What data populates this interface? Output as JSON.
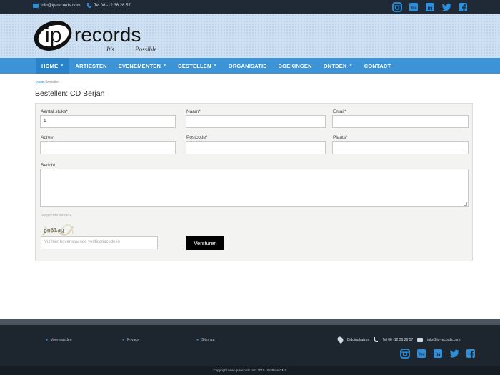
{
  "topbar": {
    "email": "info@ip-records.com",
    "phone": "Tel 06 -12 36 26 57"
  },
  "social": [
    {
      "icon": "instagram-icon",
      "glyph": "◙"
    },
    {
      "icon": "youtube-icon",
      "glyph": "▶"
    },
    {
      "icon": "linkedin-icon",
      "glyph": "in"
    },
    {
      "icon": "twitter-icon",
      "glyph": "🐦"
    },
    {
      "icon": "facebook-icon",
      "glyph": "f"
    }
  ],
  "logo": {
    "brand_ip": "ip",
    "brand_records": "records",
    "tagline_a": "It's",
    "tagline_b": "Possible"
  },
  "nav": {
    "items": [
      {
        "label": "HOME",
        "caret": "▼",
        "active": true
      },
      {
        "label": "ARTIESTEN",
        "caret": ""
      },
      {
        "label": "EVENEMENTEN",
        "caret": "▼"
      },
      {
        "label": "BESTELLEN",
        "caret": "▼"
      },
      {
        "label": "ORGANISATIE",
        "caret": ""
      },
      {
        "label": "BOEKINGEN",
        "caret": ""
      },
      {
        "label": "ONTDEK",
        "caret": "▼"
      },
      {
        "label": "CONTACT",
        "caret": ""
      }
    ]
  },
  "breadcrumb": {
    "home": "home",
    "separator": " / ",
    "current": "bestellen"
  },
  "page": {
    "title": "Bestellen: CD Berjan"
  },
  "form": {
    "aantal_label": "Aantal stuks*",
    "aantal_value": "1",
    "naam_label": "Naam*",
    "email_label": "Email*",
    "adres_label": "Adres*",
    "postcode_label": "Postcode*",
    "plaats_label": "Plaats*",
    "bericht_label": "Bericht",
    "required_note": "Verplichte velden",
    "captcha_text": "bn61ag",
    "captcha_placeholder": "Vul hier bovenstaande verificatiecode in",
    "submit_label": "Versturen"
  },
  "footer": {
    "links": [
      "Voorwaarden",
      "Privacy",
      "Sitemap"
    ],
    "city": "Biddinghuizen",
    "phone": "Tel 06 -12 36 26 57",
    "email": "info@ip-records.com",
    "copyright": "Copyright www.ip-records.nl © 2015 | Endless CMS"
  },
  "colors": {
    "nav": "#3c93d6",
    "accent": "#2d8fdb",
    "footer": "#1d262f"
  }
}
